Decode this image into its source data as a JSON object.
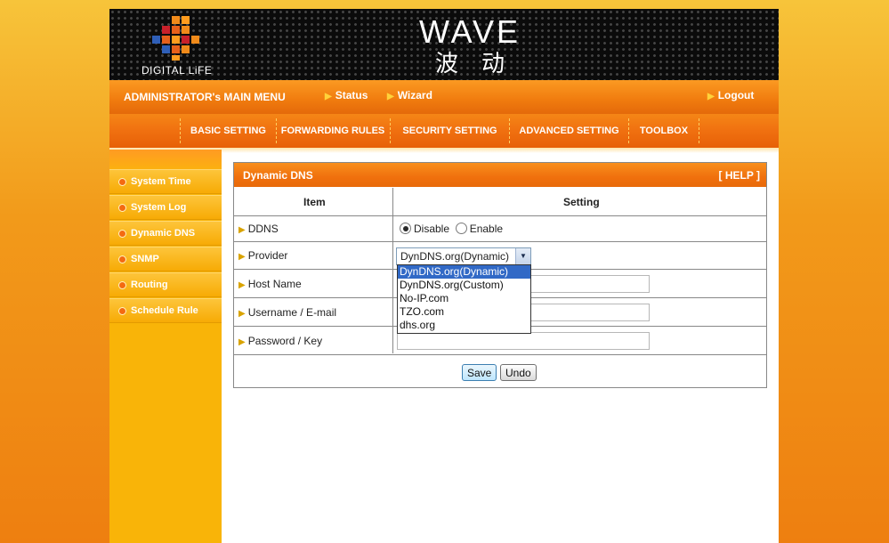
{
  "banner": {
    "logo_text": "DIGITAL LiFE",
    "brand_title": "WAVE",
    "brand_subtitle": "波动"
  },
  "menubar": {
    "title": "ADMINISTRATOR's MAIN MENU",
    "status": "Status",
    "wizard": "Wizard",
    "logout": "Logout"
  },
  "nav": {
    "tabs": [
      {
        "label": "BASIC SETTING"
      },
      {
        "label": "FORWARDING RULES"
      },
      {
        "label": "SECURITY SETTING"
      },
      {
        "label": "ADVANCED SETTING"
      },
      {
        "label": "TOOLBOX"
      }
    ]
  },
  "sidebar": {
    "items": [
      {
        "label": "System Time"
      },
      {
        "label": "System Log"
      },
      {
        "label": "Dynamic DNS"
      },
      {
        "label": "SNMP"
      },
      {
        "label": "Routing"
      },
      {
        "label": "Schedule Rule"
      }
    ]
  },
  "panel": {
    "title": "Dynamic DNS",
    "help": "[ HELP ]",
    "col_item": "Item",
    "col_setting": "Setting",
    "rows": {
      "ddns": "DDNS",
      "provider": "Provider",
      "host": "Host Name",
      "username": "Username / E-mail",
      "password": "Password / Key"
    },
    "ddns_options": {
      "disable": "Disable",
      "enable": "Enable",
      "selected": "Disable"
    },
    "provider_selected": "DynDNS.org(Dynamic)",
    "provider_options": [
      "DynDNS.org(Dynamic)",
      "DynDNS.org(Custom)",
      "No-IP.com",
      "TZO.com",
      "dhs.org"
    ],
    "host_value": "",
    "username_value": "",
    "password_value": "",
    "save": "Save",
    "undo": "Undo"
  },
  "colors": {
    "orange": "#f07b0e",
    "sidebar_yellow": "#f9b408",
    "selection_blue": "#3169c6"
  }
}
